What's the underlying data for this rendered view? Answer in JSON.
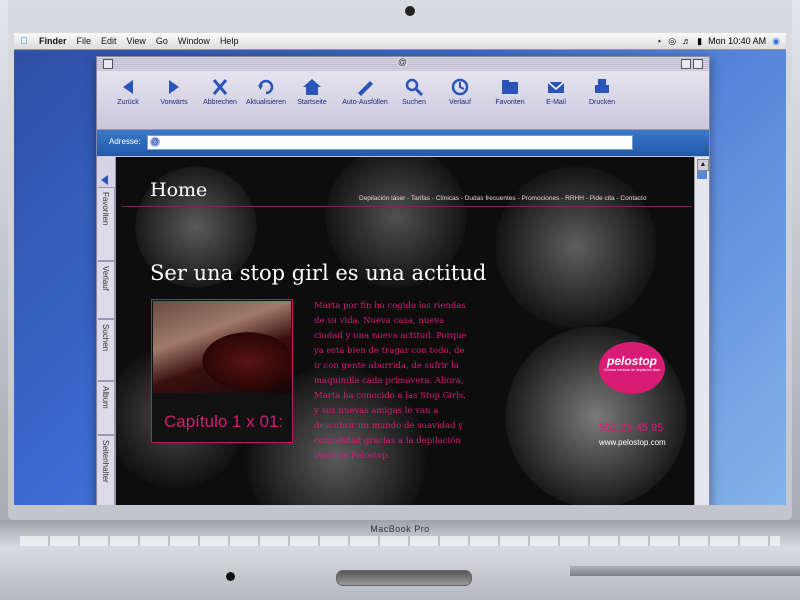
{
  "menubar": {
    "app": "Finder",
    "items": [
      "File",
      "Edit",
      "View",
      "Go",
      "Window",
      "Help"
    ],
    "clock": "Mon 10:40 AM"
  },
  "toolbar": {
    "buttons": [
      "Zurück",
      "Vorwärts",
      "Abbrechen",
      "Aktualisieren",
      "Startseite",
      "Auto-Ausfüllen",
      "Suchen",
      "Verlauf",
      "Favoriten",
      "E-Mail",
      "Drucken"
    ]
  },
  "address": {
    "label": "Adresse:",
    "value": ""
  },
  "sidetabs": [
    "Favoriten",
    "Verlauf",
    "Suchen",
    "Album",
    "Seitenhalter"
  ],
  "page": {
    "home": "Home",
    "nav": "Depilación láser - Tarifas - Clínicas - Dudas frecuentes - Promociones - RRHH - Pide cita - Contacto",
    "headline": "Ser una stop girl es una actitud",
    "caption": "Capítulo 1 x 01:",
    "story": "Marta por fin ha cogido las riendas de su vida. Nueva casa, nueva ciudad y una nueva actitud. Porque ya está bien de tragar con todo, de ir con gente aburrida, de sufrir la maquinilla cada primavera. Ahora, Marta ha conocido a las Stop Girls, y sus nuevas amigas le van a descubrir un mundo de suavidad y comodidad gracias a la depilación láser de Pelostop.",
    "logo_word": "pelostop",
    "logo_tagline": "Clínicas médicas de depilación láser",
    "phone": "902 25 45 95",
    "website": "www.pelostop.com"
  },
  "laptop": {
    "brand": "MacBook Pro"
  },
  "colors": {
    "accent": "#d81b75",
    "toolbar_text": "#1a2a80",
    "address_bar": "#1e5aa8"
  }
}
